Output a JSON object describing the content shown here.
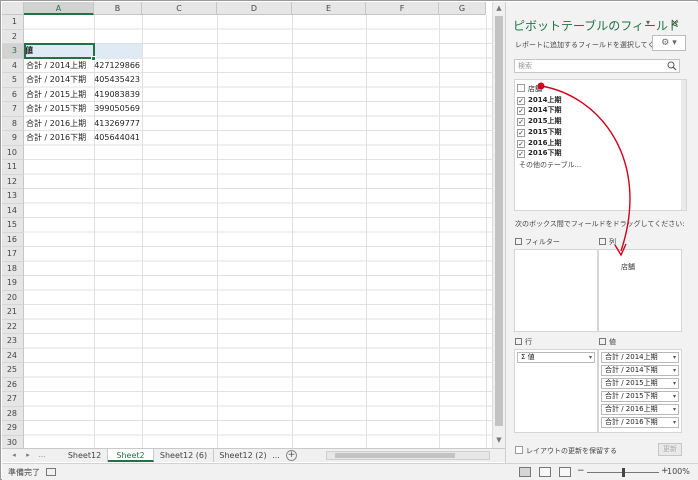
{
  "sheet": {
    "columns": [
      "A",
      "B",
      "C",
      "D",
      "E",
      "F",
      "G"
    ],
    "rows": [
      "1",
      "2",
      "3",
      "4",
      "5",
      "6",
      "7",
      "8",
      "9",
      "10",
      "11",
      "12",
      "13",
      "14",
      "15",
      "16",
      "17",
      "18",
      "19",
      "20",
      "21",
      "22",
      "23",
      "24",
      "25",
      "26",
      "27",
      "28",
      "29",
      "30"
    ],
    "cells": {
      "a3": "値",
      "rows": [
        {
          "label": "合計 / 2014上期",
          "value": "427129866"
        },
        {
          "label": "合計 / 2014下期",
          "value": "405435423"
        },
        {
          "label": "合計 / 2015上期",
          "value": "419083839"
        },
        {
          "label": "合計 / 2015下期",
          "value": "399050569"
        },
        {
          "label": "合計 / 2016上期",
          "value": "413269777"
        },
        {
          "label": "合計 / 2016下期",
          "value": "405644041"
        }
      ]
    }
  },
  "tabs": {
    "nav_prev": "◂",
    "nav_next": "▸",
    "nav_more": "...",
    "items": [
      "Sheet12",
      "Sheet2",
      "Sheet12 (6)",
      "Sheet12 (2)"
    ],
    "active": "Sheet2",
    "more": "...",
    "add": "+"
  },
  "status": {
    "ready": "準備完了",
    "zoom": "100%",
    "zoom_level": 1.0,
    "minus": "−",
    "plus": "+"
  },
  "pivot": {
    "title": "ピボットテーブルのフィールド",
    "dropdown": "▾",
    "close": "×",
    "subtitle": "レポートに追加するフィールドを選択してください:",
    "gear": "⚙ ▾",
    "search_placeholder": "検索",
    "fields": [
      {
        "label": "店舗",
        "checked": false
      },
      {
        "label": "2014上期",
        "checked": true
      },
      {
        "label": "2014下期",
        "checked": true
      },
      {
        "label": "2015上期",
        "checked": true
      },
      {
        "label": "2015下期",
        "checked": true
      },
      {
        "label": "2016上期",
        "checked": true
      },
      {
        "label": "2016下期",
        "checked": true
      }
    ],
    "more_tables": "その他のテーブル...",
    "drag_hint": "次のボックス間でフィールドをドラッグしてください:",
    "zones": {
      "filter": "フィルター",
      "columns": "列",
      "rows": "行",
      "values": "値"
    },
    "row_items": [
      "Σ 値"
    ],
    "value_items": [
      "合計 / 2014上期",
      "合計 / 2014下期",
      "合計 / 2015上期",
      "合計 / 2015下期",
      "合計 / 2016上期",
      "合計 / 2016下期"
    ],
    "drag_ghost": "店舗",
    "defer_label": "レイアウトの更新を保留する",
    "update_button": "更新"
  },
  "colors": {
    "accent": "#217346",
    "arrow": "#d0021b"
  }
}
